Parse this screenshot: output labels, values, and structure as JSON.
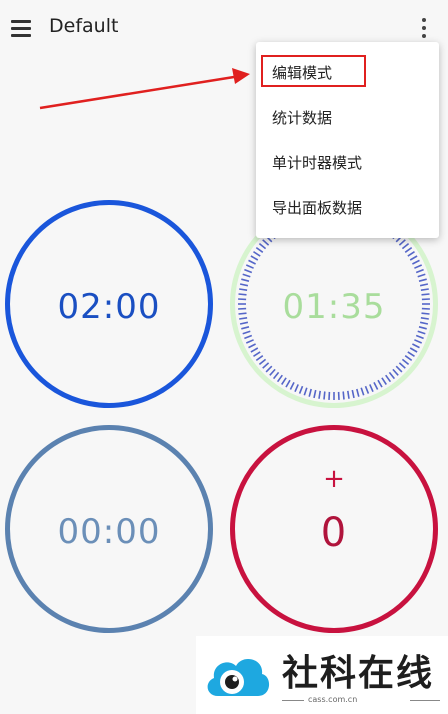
{
  "appbar": {
    "title": "Default",
    "menu_icon": "hamburger-menu-icon",
    "overflow_icon": "more-vert-icon"
  },
  "timers": [
    {
      "time": "02:00",
      "color": "#1a56db"
    },
    {
      "time": "01:35",
      "color": "#a9dd9c",
      "tick_color": "#5566c8"
    },
    {
      "time": "00:00",
      "color": "#5b82b0"
    },
    {
      "plus": "+",
      "count": "0",
      "color": "#c8123f"
    }
  ],
  "dropdown": {
    "items": [
      "编辑模式",
      "统计数据",
      "单计时器模式",
      "导出面板数据"
    ],
    "highlight_color": "#e0201f"
  },
  "watermark": {
    "text": "社科在线",
    "subtext": "cass.com.cn",
    "cloud_color": "#1ea8e0"
  }
}
